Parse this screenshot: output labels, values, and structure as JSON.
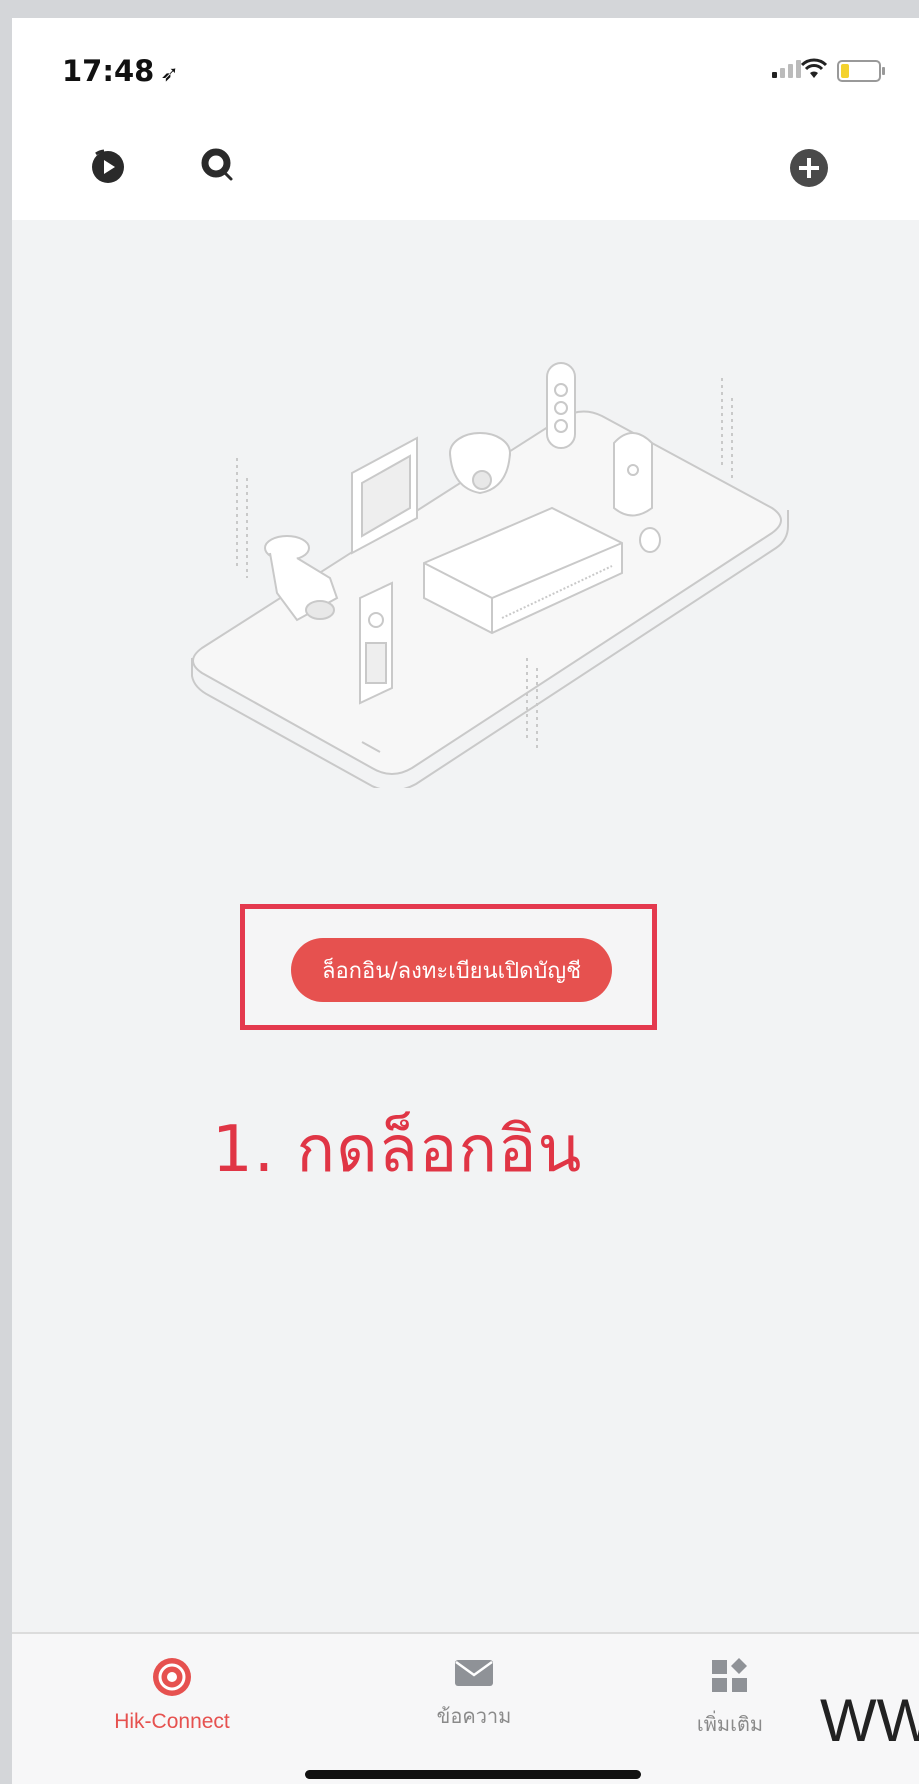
{
  "status_bar": {
    "time": "17:48",
    "location_glyph": "➶"
  },
  "top_bar": {
    "icons": [
      "playback-icon",
      "search-icon",
      "add-device-icon"
    ]
  },
  "main": {
    "login_button_label": "ล็อกอิน/ลงทะเบียนเปิดบัญชี",
    "instruction_text": "1. กดล็อกอิน"
  },
  "tab_bar": {
    "tabs": [
      {
        "label": "Hik-Connect",
        "icon": "hik-connect-icon",
        "active": true
      },
      {
        "label": "ข้อความ",
        "icon": "envelope-icon",
        "active": false
      },
      {
        "label": "เพิ่มเติม",
        "icon": "grid-more-icon",
        "active": false
      }
    ]
  },
  "watermark": {
    "text": "WW"
  },
  "colors": {
    "accent": "#e6514f",
    "annotation": "#e03545"
  }
}
